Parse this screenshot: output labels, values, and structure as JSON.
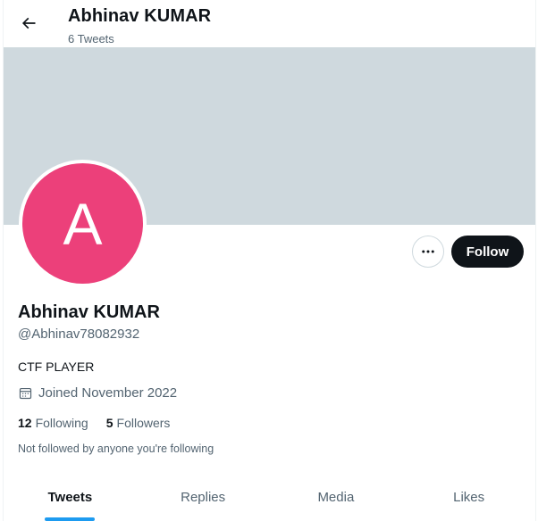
{
  "header": {
    "title": "Abhinav KUMAR",
    "tweet_count": "6 Tweets"
  },
  "profile": {
    "avatar_letter": "A",
    "avatar_color": "#ec407a",
    "banner_color": "#cfd9de",
    "name": "Abhinav KUMAR",
    "handle": "@Abhinav78082932",
    "bio": "CTF PLAYER",
    "joined": "Joined November 2022",
    "following_count": "12",
    "following_label": "Following",
    "followers_count": "5",
    "followers_label": "Followers",
    "not_followed_note": "Not followed by anyone you're following"
  },
  "actions": {
    "follow_label": "Follow",
    "more_icon": "more-horizontal-icon"
  },
  "tabs": [
    {
      "label": "Tweets",
      "active": true
    },
    {
      "label": "Replies",
      "active": false
    },
    {
      "label": "Media",
      "active": false
    },
    {
      "label": "Likes",
      "active": false
    }
  ],
  "accent_color": "#1d9bf0"
}
